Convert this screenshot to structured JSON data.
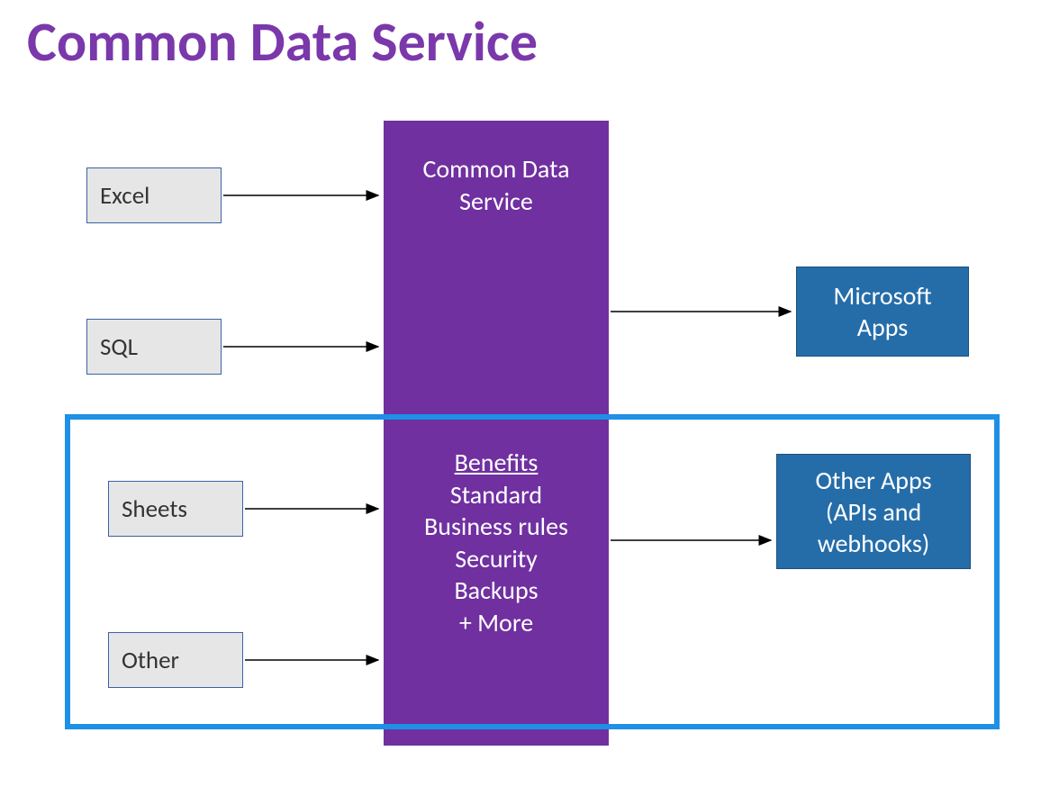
{
  "title": "Common Data Service",
  "inputs": {
    "excel": "Excel",
    "sql": "SQL",
    "sheets": "Sheets",
    "other": "Other"
  },
  "center": {
    "heading": "Common Data Service",
    "benefits_label": "Benefits",
    "benefit1": "Standard",
    "benefit2": "Business rules",
    "benefit3": "Security",
    "benefit4": "Backups",
    "benefit5": "+ More"
  },
  "outputs": {
    "ms_apps_line1": "Microsoft",
    "ms_apps_line2": "Apps",
    "other_apps_line1": "Other Apps",
    "other_apps_line2": "(APIs and",
    "other_apps_line3": "webhooks)"
  },
  "colors": {
    "title": "#7A38AB",
    "center_bg": "#7030A0",
    "input_bg": "#E7E6E6",
    "input_border": "#3A62A7",
    "output_bg": "#256DA9",
    "highlight": "#1E90E5"
  }
}
